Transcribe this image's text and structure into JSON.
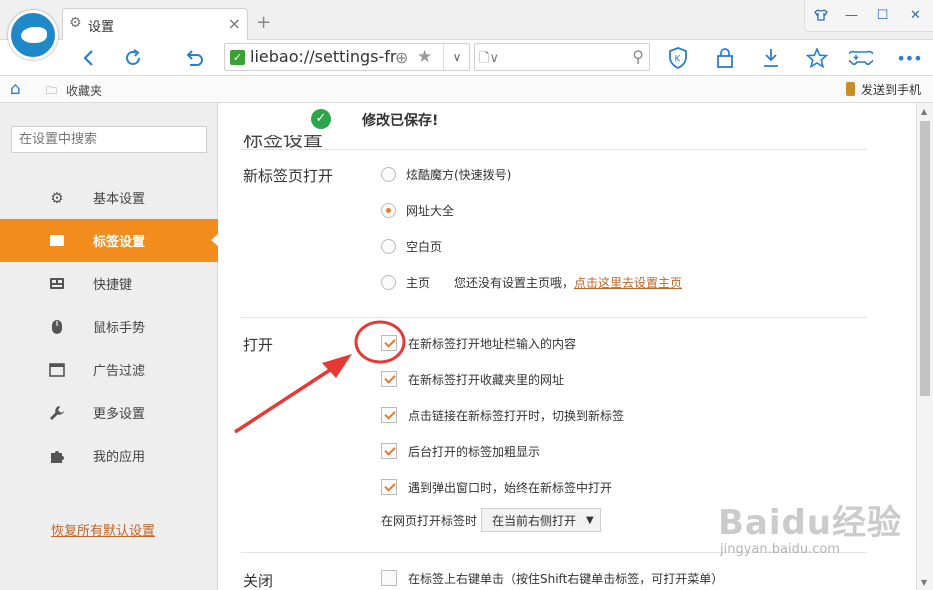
{
  "browser": {
    "tab_title": "设置",
    "address": "liebao://settings-frame/tabs",
    "bookmarks_label": "收藏夹",
    "send_to_phone": "发送到手机"
  },
  "sidebar": {
    "search_placeholder": "在设置中搜索",
    "items": [
      {
        "label": "基本设置"
      },
      {
        "label": "标签设置"
      },
      {
        "label": "快捷键"
      },
      {
        "label": "鼠标手势"
      },
      {
        "label": "广告过滤"
      },
      {
        "label": "更多设置"
      },
      {
        "label": "我的应用"
      }
    ],
    "active": "标签设置",
    "restore_label": "恢复所有默认设置"
  },
  "main": {
    "saved_message": "修改已保存!",
    "section_title": "标签设置",
    "new_tab": {
      "label": "新标签页打开",
      "options": [
        "炫酷魔方(快速拨号)",
        "网址大全",
        "空白页",
        "主页"
      ],
      "selected": "网址大全",
      "homepage_note": "您还没有设置主页哦，",
      "homepage_link": "点击这里去设置主页"
    },
    "open": {
      "label": "打开",
      "checkboxes": [
        {
          "label": "在新标签打开地址栏输入的内容",
          "checked": true
        },
        {
          "label": "在新标签打开收藏夹里的网址",
          "checked": true
        },
        {
          "label": "点击链接在新标签打开时，切换到新标签",
          "checked": true
        },
        {
          "label": "后台打开的标签加粗显示",
          "checked": true
        },
        {
          "label": "遇到弹出窗口时，始终在新标签中打开",
          "checked": true
        }
      ],
      "position_label": "在网页打开标签时",
      "position_value": "在当前右侧打开"
    },
    "close": {
      "label": "关闭",
      "checkboxes": [
        {
          "label": "在标签上右键单击（按住Shift右键单击标签，可打开菜单）",
          "checked": false
        }
      ]
    }
  },
  "watermark": {
    "main": "Baidu经验",
    "sub": "jingyan.baidu.com"
  },
  "colors": {
    "accent": "#f28c1c",
    "link": "#c0652a",
    "annotation": "#e53935",
    "saved_icon": "#2ea34a"
  }
}
